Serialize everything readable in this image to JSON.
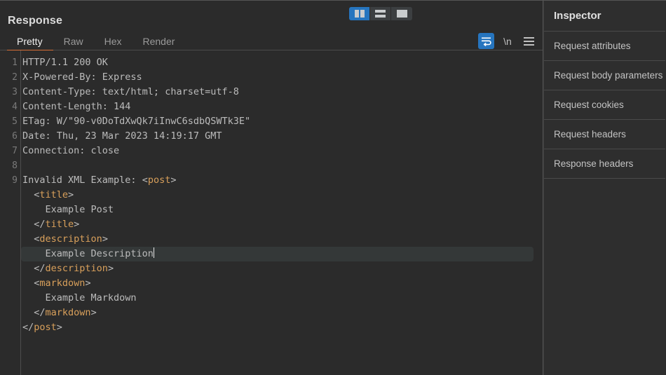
{
  "window": {
    "theme_background": "#2b2b2b",
    "accent_color": "#d86f36",
    "selection_color": "#2675bf"
  },
  "response_panel": {
    "title": "Response",
    "tabs": [
      {
        "label": "Pretty",
        "active": true
      },
      {
        "label": "Raw",
        "active": false
      },
      {
        "label": "Hex",
        "active": false
      },
      {
        "label": "Render",
        "active": false
      }
    ],
    "layout_toggle": [
      {
        "name": "split-vertical-layout",
        "active": true
      },
      {
        "name": "split-horizontal-layout",
        "active": false
      },
      {
        "name": "single-pane-layout",
        "active": false
      }
    ],
    "tools": [
      {
        "name": "word-wrap-icon",
        "label": "",
        "active": true
      },
      {
        "name": "newline-toggle",
        "label": "\\n",
        "active": false
      },
      {
        "name": "menu-icon",
        "label": "",
        "active": false
      }
    ],
    "code": {
      "lines": [
        {
          "num": "1",
          "segments": [
            {
              "t": "HTTP/1.1 200 OK",
              "c": "plain"
            }
          ]
        },
        {
          "num": "2",
          "segments": [
            {
              "t": "X-Powered-By: Express",
              "c": "plain"
            }
          ]
        },
        {
          "num": "3",
          "segments": [
            {
              "t": "Content-Type: text/html; charset=utf-8",
              "c": "plain"
            }
          ]
        },
        {
          "num": "4",
          "segments": [
            {
              "t": "Content-Length: 144",
              "c": "plain"
            }
          ]
        },
        {
          "num": "5",
          "segments": [
            {
              "t": "ETag: W/\"90-v0DoTdXwQk7iInwC6sdbQSWTk3E\"",
              "c": "plain"
            }
          ]
        },
        {
          "num": "6",
          "segments": [
            {
              "t": "Date: Thu, 23 Mar 2023 14:19:17 GMT",
              "c": "plain"
            }
          ]
        },
        {
          "num": "7",
          "segments": [
            {
              "t": "Connection: close",
              "c": "plain"
            }
          ]
        },
        {
          "num": "8",
          "segments": [
            {
              "t": "",
              "c": "plain"
            }
          ]
        },
        {
          "num": "9",
          "segments": [
            {
              "t": "Invalid XML Example: ",
              "c": "plain"
            },
            {
              "t": "<",
              "c": "punct"
            },
            {
              "t": "post",
              "c": "tag"
            },
            {
              "t": ">",
              "c": "punct"
            }
          ]
        },
        {
          "num": "",
          "segments": [
            {
              "t": "  ",
              "c": "plain"
            },
            {
              "t": "<",
              "c": "punct"
            },
            {
              "t": "title",
              "c": "tag"
            },
            {
              "t": ">",
              "c": "punct"
            }
          ]
        },
        {
          "num": "",
          "segments": [
            {
              "t": "    Example Post",
              "c": "plain"
            }
          ]
        },
        {
          "num": "",
          "segments": [
            {
              "t": "  ",
              "c": "plain"
            },
            {
              "t": "</",
              "c": "punct"
            },
            {
              "t": "title",
              "c": "tag"
            },
            {
              "t": ">",
              "c": "punct"
            }
          ]
        },
        {
          "num": "",
          "segments": [
            {
              "t": "  ",
              "c": "plain"
            },
            {
              "t": "<",
              "c": "punct"
            },
            {
              "t": "description",
              "c": "tag"
            },
            {
              "t": ">",
              "c": "punct"
            }
          ]
        },
        {
          "num": "",
          "current": true,
          "caret": true,
          "segments": [
            {
              "t": "    Example Description",
              "c": "plain"
            }
          ]
        },
        {
          "num": "",
          "segments": [
            {
              "t": "  ",
              "c": "plain"
            },
            {
              "t": "</",
              "c": "punct"
            },
            {
              "t": "description",
              "c": "tag"
            },
            {
              "t": ">",
              "c": "punct"
            }
          ]
        },
        {
          "num": "",
          "segments": [
            {
              "t": "  ",
              "c": "plain"
            },
            {
              "t": "<",
              "c": "punct"
            },
            {
              "t": "markdown",
              "c": "tag"
            },
            {
              "t": ">",
              "c": "punct"
            }
          ]
        },
        {
          "num": "",
          "segments": [
            {
              "t": "    Example Markdown",
              "c": "plain"
            }
          ]
        },
        {
          "num": "",
          "segments": [
            {
              "t": "  ",
              "c": "plain"
            },
            {
              "t": "</",
              "c": "punct"
            },
            {
              "t": "markdown",
              "c": "tag"
            },
            {
              "t": ">",
              "c": "punct"
            }
          ]
        },
        {
          "num": "",
          "segments": [
            {
              "t": "</",
              "c": "punct"
            },
            {
              "t": "post",
              "c": "tag"
            },
            {
              "t": ">",
              "c": "punct"
            }
          ]
        }
      ]
    }
  },
  "inspector": {
    "title": "Inspector",
    "items": [
      {
        "label": "Request attributes"
      },
      {
        "label": "Request body parameters"
      },
      {
        "label": "Request cookies"
      },
      {
        "label": "Request headers"
      },
      {
        "label": "Response headers"
      }
    ]
  }
}
